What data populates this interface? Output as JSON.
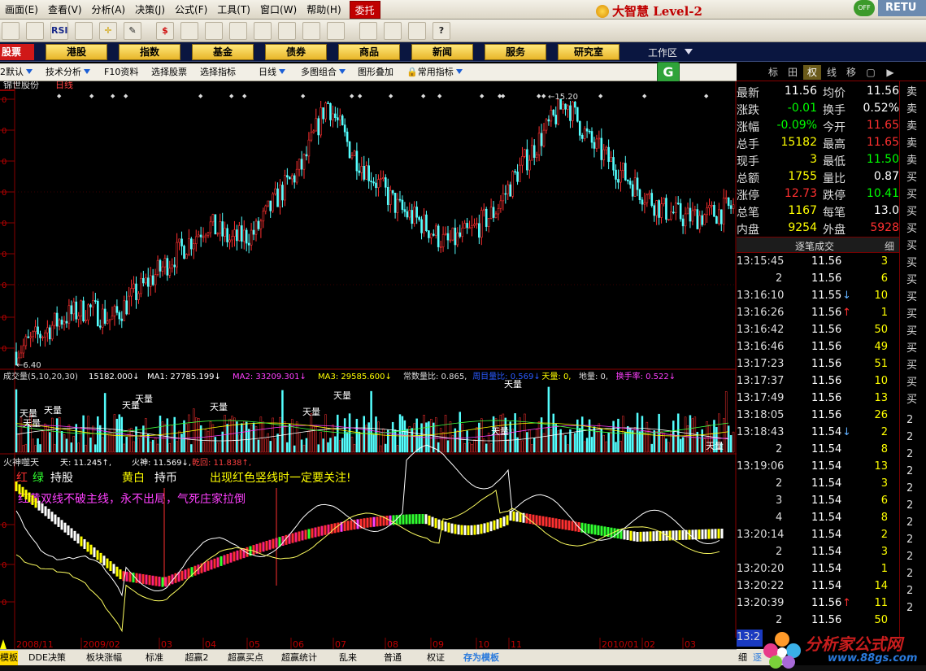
{
  "menu": [
    "画面(E)",
    "查看(V)",
    "分析(A)",
    "决策(J)",
    "公式(F)",
    "工具(T)",
    "窗口(W)",
    "帮助(H)"
  ],
  "menu_highlight": "委托",
  "brand": "大智慧 Level-2",
  "off_badge": "OFF",
  "retu": "RETU",
  "toolbar_icons": [
    {
      "icon": "grid-icon",
      "label": ""
    },
    {
      "icon": "table-icon",
      "label": ""
    },
    {
      "icon": "rsi-icon",
      "label": "RSI"
    },
    {
      "icon": "list-icon",
      "label": ""
    },
    {
      "icon": "crosshair-icon",
      "label": "✛"
    },
    {
      "icon": "ruler-icon",
      "label": "✎"
    },
    {
      "icon": "dollar-icon",
      "label": "$"
    },
    {
      "icon": "bars-icon",
      "label": ""
    },
    {
      "icon": "binoculars-icon",
      "label": ""
    },
    {
      "icon": "alarm-icon",
      "label": ""
    },
    {
      "icon": "chart-icon",
      "label": ""
    },
    {
      "icon": "diamond-icon",
      "label": ""
    },
    {
      "icon": "red-circle-icon",
      "label": ""
    },
    {
      "icon": "blue-circle-icon",
      "label": ""
    },
    {
      "icon": "calc-icon",
      "label": ""
    },
    {
      "icon": "window-icon",
      "label": ""
    },
    {
      "icon": "books-icon",
      "label": ""
    },
    {
      "icon": "help-cursor-icon",
      "label": "?"
    }
  ],
  "nav_left": "股票",
  "nav": [
    "港股",
    "指数",
    "基金",
    "债券",
    "商品",
    "新闻",
    "服务",
    "研究室"
  ],
  "workspace": "工作区",
  "subbar": [
    "2默认",
    "技术分析",
    "F10资料",
    "选择股票",
    "选择指标",
    "日线",
    "多图组合",
    "图形叠加",
    "常用指标"
  ],
  "right_tabs": [
    "标",
    "田",
    "权",
    "线",
    "移",
    "▢",
    "▶"
  ],
  "stock": {
    "name": "锦世股份",
    "period": "日线"
  },
  "price_chart": {
    "high_label": "15.20",
    "low_label": "6.40"
  },
  "volume_header": {
    "title": "成交量(5,10,20,30)",
    "vol": "15182.000↓",
    "ma1": "MA1: 27785.199↓",
    "ma2": "MA2: 33209.301↓",
    "ma3": "MA3: 29585.600↓",
    "ratio": "常数量比: 0.865,",
    "ratio2": "周目量比: 0.569↓",
    "tianliang": "天量: 0,",
    "diliang": "地量: 0,",
    "turnover": "换手率: 0.522↓"
  },
  "volume_markers": [
    "天量",
    "天量",
    "天量",
    "天量",
    "天量",
    "天量",
    "天量",
    "天量",
    "天量",
    "天量",
    "天量"
  ],
  "indicator": {
    "name": "火神噬天",
    "tian": "天: 11.245↑,",
    "huoshen": "火神: 11.569↓,",
    "qiankun": "乾回: 11.838↑,",
    "legend_red": "红",
    "legend_green": "绿",
    "legend_hold": "持股",
    "legend_yw": "黄白",
    "legend_cash": "持币",
    "tip1": "出现红色竖线时一定要关注!",
    "tip2": "红黄双线不破主线，永不出局，气死庄家拉倒"
  },
  "quote": [
    {
      "l1": "最新",
      "v1": "11.56",
      "c1": "#ffffff",
      "l2": "均价",
      "v2": "11.56",
      "c2": "#ffffff"
    },
    {
      "l1": "涨跌",
      "v1": "-0.01",
      "c1": "#00ff00",
      "l2": "换手",
      "v2": "0.52%",
      "c2": "#ffffff"
    },
    {
      "l1": "涨幅",
      "v1": "-0.09%",
      "c1": "#00ff00",
      "l2": "今开",
      "v2": "11.65",
      "c2": "#ff3030"
    },
    {
      "l1": "总手",
      "v1": "15182",
      "c1": "#ffff00",
      "l2": "最高",
      "v2": "11.65",
      "c2": "#ff3030"
    },
    {
      "l1": "现手",
      "v1": "3",
      "c1": "#ffff00",
      "l2": "最低",
      "v2": "11.50",
      "c2": "#00ff00"
    },
    {
      "l1": "总额",
      "v1": "1755",
      "c1": "#ffff00",
      "l2": "量比",
      "v2": "0.87",
      "c2": "#ffffff"
    },
    {
      "l1": "涨停",
      "v1": "12.73",
      "c1": "#ff3030",
      "l2": "跌停",
      "v2": "10.41",
      "c2": "#00ff00"
    },
    {
      "l1": "总笔",
      "v1": "1167",
      "c1": "#ffff00",
      "l2": "每笔",
      "v2": "13.0",
      "c2": "#ffffff"
    },
    {
      "l1": "内盘",
      "v1": "9254",
      "c1": "#ffff00",
      "l2": "外盘",
      "v2": "5928",
      "c2": "#ff3030"
    }
  ],
  "ticks_header": "逐笔成交",
  "ticks_detail": "细",
  "ticks": [
    {
      "t": "13:15:45",
      "p": "11.56",
      "a": "",
      "v": "3"
    },
    {
      "t": "2",
      "p": "11.56",
      "a": "",
      "v": "6"
    },
    {
      "t": "13:16:10",
      "p": "11.55",
      "a": "↓",
      "v": "10"
    },
    {
      "t": "13:16:26",
      "p": "11.56",
      "a": "↑",
      "v": "1"
    },
    {
      "t": "13:16:42",
      "p": "11.56",
      "a": "",
      "v": "50"
    },
    {
      "t": "13:16:46",
      "p": "11.56",
      "a": "",
      "v": "49"
    },
    {
      "t": "13:17:23",
      "p": "11.56",
      "a": "",
      "v": "51"
    },
    {
      "t": "13:17:37",
      "p": "11.56",
      "a": "",
      "v": "10"
    },
    {
      "t": "13:17:49",
      "p": "11.56",
      "a": "",
      "v": "13"
    },
    {
      "t": "13:18:05",
      "p": "11.56",
      "a": "",
      "v": "26"
    },
    {
      "t": "13:18:43",
      "p": "11.54",
      "a": "↓",
      "v": "2"
    },
    {
      "t": "2",
      "p": "11.54",
      "a": "",
      "v": "8"
    },
    {
      "t": "13:19:06",
      "p": "11.54",
      "a": "",
      "v": "13"
    },
    {
      "t": "2",
      "p": "11.54",
      "a": "",
      "v": "3"
    },
    {
      "t": "3",
      "p": "11.54",
      "a": "",
      "v": "6"
    },
    {
      "t": "4",
      "p": "11.54",
      "a": "",
      "v": "8"
    },
    {
      "t": "13:20:14",
      "p": "11.54",
      "a": "",
      "v": "2"
    },
    {
      "t": "2",
      "p": "11.54",
      "a": "",
      "v": "3"
    },
    {
      "t": "13:20:20",
      "p": "11.54",
      "a": "",
      "v": "1"
    },
    {
      "t": "13:20:22",
      "p": "11.54",
      "a": "",
      "v": "14"
    },
    {
      "t": "13:20:39",
      "p": "11.56",
      "a": "↑",
      "v": "11"
    },
    {
      "t": "2",
      "p": "11.56",
      "a": "",
      "v": "50"
    },
    {
      "t": "13:2",
      "p": "",
      "a": "",
      "v": ""
    }
  ],
  "far_right": [
    "卖",
    "卖",
    "卖",
    "卖",
    "卖",
    "买",
    "买",
    "买",
    "买",
    "买",
    "买",
    "买",
    "买",
    "买",
    "买",
    "买",
    "买",
    "买",
    "买",
    "2",
    "2",
    "2",
    "2",
    "2",
    "2",
    "2",
    "2",
    "2",
    "2",
    "2",
    "2"
  ],
  "time_labels": [
    "2008/11",
    "2009/02",
    "03",
    "04",
    "05",
    "06",
    "07",
    "08",
    "09",
    "10",
    "11",
    "2010/01",
    "02",
    "03"
  ],
  "bottom_tabs": [
    "模板",
    "DDE决策",
    "板块涨幅",
    "标准",
    "超赢2",
    "超赢买点",
    "超赢统计",
    "乱来",
    "普通",
    "权证",
    "存为模板"
  ],
  "bottom_right": [
    "细",
    "逐"
  ],
  "watermark": {
    "text": "分析家公式网",
    "url": "www.88gs.com"
  },
  "chart_data": {
    "type": "line",
    "x_labels": [
      "2008/11",
      "2009/02",
      "03",
      "04",
      "05",
      "06",
      "07",
      "08",
      "09",
      "10",
      "11",
      "2010/01",
      "02",
      "03"
    ],
    "price_close": [
      6.6,
      7.2,
      7.8,
      8.1,
      7.7,
      8.6,
      9.4,
      10.2,
      11.0,
      10.4,
      10.7,
      12.0,
      13.0,
      15.2,
      13.5,
      12.5,
      11.5,
      11.0,
      10.3,
      10.7,
      11.4,
      12.8,
      14.0,
      15.2,
      13.8,
      13.0,
      12.2,
      11.5,
      11.2,
      11.3,
      11.56
    ],
    "price_high": 15.2,
    "price_low": 6.4,
    "volume_ma": [
      15182.0,
      27785.199,
      33209.301,
      29585.6
    ],
    "indicator_values": {
      "tian": 11.245,
      "huoshen": 11.569,
      "qiankun": 11.838
    }
  }
}
